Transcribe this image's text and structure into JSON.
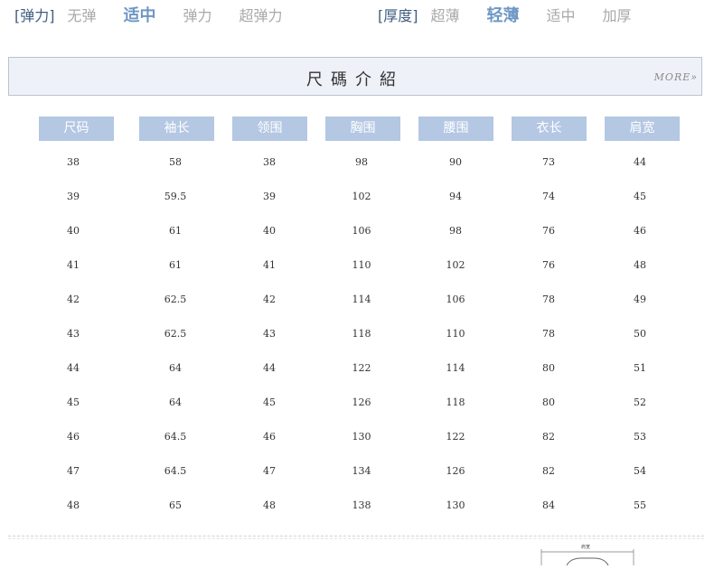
{
  "attributes": {
    "elasticity": {
      "label": "[弹力]",
      "options": [
        "无弹",
        "适中",
        "弹力",
        "超弹力"
      ],
      "selected": "适中"
    },
    "thickness": {
      "label": "[厚度]",
      "options": [
        "超薄",
        "轻薄",
        "适中",
        "加厚"
      ],
      "selected": "轻薄"
    }
  },
  "banner": {
    "title": "尺碼介紹",
    "more": "MORE»"
  },
  "size_table": {
    "headers": [
      "尺码",
      "袖长",
      "领围",
      "胸围",
      "腰围",
      "衣长",
      "肩宽"
    ],
    "rows": [
      [
        "38",
        "58",
        "38",
        "98",
        "90",
        "73",
        "44"
      ],
      [
        "39",
        "59.5",
        "39",
        "102",
        "94",
        "74",
        "45"
      ],
      [
        "40",
        "61",
        "40",
        "106",
        "98",
        "76",
        "46"
      ],
      [
        "41",
        "61",
        "41",
        "110",
        "102",
        "76",
        "48"
      ],
      [
        "42",
        "62.5",
        "42",
        "114",
        "106",
        "78",
        "49"
      ],
      [
        "43",
        "62.5",
        "43",
        "118",
        "110",
        "78",
        "50"
      ],
      [
        "44",
        "64",
        "44",
        "122",
        "114",
        "80",
        "51"
      ],
      [
        "45",
        "64",
        "45",
        "126",
        "118",
        "80",
        "52"
      ],
      [
        "46",
        "64.5",
        "46",
        "130",
        "122",
        "82",
        "53"
      ],
      [
        "47",
        "64.5",
        "47",
        "134",
        "126",
        "82",
        "54"
      ],
      [
        "48",
        "65",
        "48",
        "138",
        "130",
        "84",
        "55"
      ]
    ]
  },
  "diagram": {
    "label": "肩宽"
  },
  "colors": {
    "header_bg": "#b4c7e3",
    "selected_option": "#6e97c4",
    "banner_bg": "#eef2f8"
  }
}
